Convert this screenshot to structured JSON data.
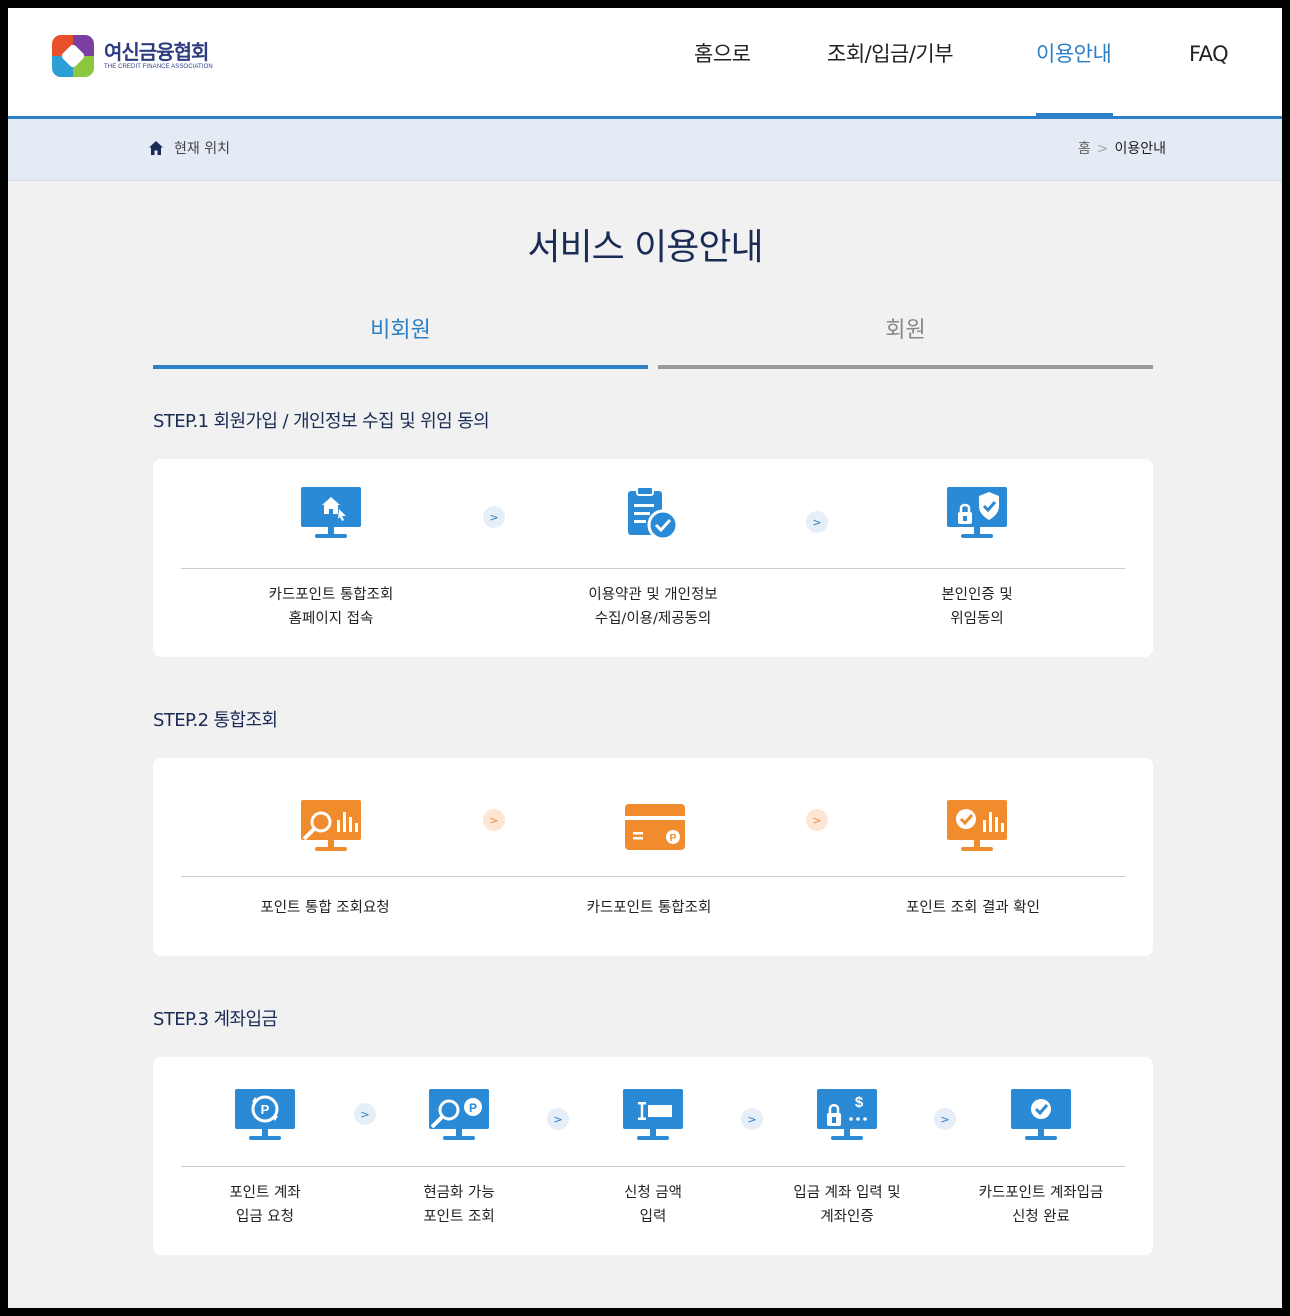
{
  "header": {
    "logo_title": "여신금융협회",
    "logo_subtitle": "THE CREDIT FINANCE ASSOCIATION",
    "nav": [
      {
        "label": "홈으로"
      },
      {
        "label": "조회/입금/기부"
      },
      {
        "label": "이용안내",
        "active": true
      },
      {
        "label": "FAQ"
      }
    ]
  },
  "breadcrumb": {
    "label": "현재 위치",
    "home": "홈",
    "separator": ">",
    "current": "이용안내"
  },
  "page_title": "서비스 이용안내",
  "tabs": [
    {
      "label": "비회원",
      "active": true
    },
    {
      "label": "회원",
      "active": false
    }
  ],
  "steps": [
    {
      "title": "STEP.1 회원가입 / 개인정보 수집 및 위임 동의",
      "items": [
        {
          "icon": "monitor-home-icon",
          "line1": "카드포인트 통합조회",
          "line2": "홈페이지 접속"
        },
        {
          "icon": "clipboard-check-icon",
          "line1": "이용약관 및 개인정보",
          "line2": "수집/이용/제공동의"
        },
        {
          "icon": "monitor-shield-icon",
          "line1": "본인인증 및",
          "line2": "위임동의"
        }
      ]
    },
    {
      "title": "STEP.2 통합조회",
      "items": [
        {
          "icon": "monitor-search-chart-icon",
          "line1": "포인트 통합 조회요청"
        },
        {
          "icon": "point-card-icon",
          "line1": "카드포인트 통합조회"
        },
        {
          "icon": "monitor-check-chart-icon",
          "line1": "포인트 조회 결과 확인"
        }
      ]
    },
    {
      "title": "STEP.3 계좌입금",
      "items": [
        {
          "icon": "monitor-point-refresh-icon",
          "line1": "포인트 계좌",
          "line2": "입금 요청"
        },
        {
          "icon": "monitor-search-point-icon",
          "line1": "현금화 가능",
          "line2": "포인트 조회"
        },
        {
          "icon": "monitor-input-icon",
          "line1": "신청 금액",
          "line2": "입력"
        },
        {
          "icon": "monitor-lock-dollar-icon",
          "line1": "입금 계좌 입력 및",
          "line2": "계좌인증"
        },
        {
          "icon": "monitor-check-icon",
          "line1": "카드포인트 계좌입금",
          "line2": "신청 완료"
        }
      ]
    }
  ],
  "colors": {
    "primary": "#2b80c7",
    "navy": "#1a2c55",
    "icon_blue": "#2a8ad6",
    "icon_orange": "#f08b2e"
  }
}
